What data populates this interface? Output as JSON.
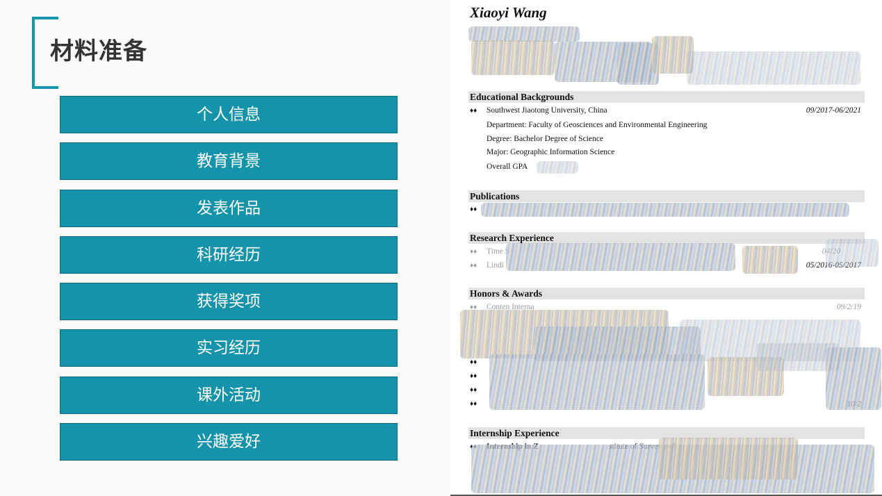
{
  "slide": {
    "title": "材料准备",
    "menu": [
      {
        "label": "个人信息"
      },
      {
        "label": "教育背景"
      },
      {
        "label": "发表作品"
      },
      {
        "label": "科研经历"
      },
      {
        "label": "获得奖项"
      },
      {
        "label": "实习经历"
      },
      {
        "label": "课外活动"
      },
      {
        "label": "兴趣爱好"
      }
    ],
    "accent_color": "#1593ab"
  },
  "resume": {
    "name": "Xiaoyi Wang",
    "sections": {
      "education": {
        "heading": "Educational Backgrounds",
        "school": "Southwest Jiaotong University, China",
        "dates": "09/2017-06/2021",
        "department": "Department: Faculty of Geosciences and Environmental Engineering",
        "degree": "Degree: Bachelor Degree of Science",
        "major": "Major: Geographic Information Science",
        "gpa_label": "Overall GPA"
      },
      "publications": {
        "heading": "Publications"
      },
      "research": {
        "heading": "Research Experience",
        "item1_start": "Time S",
        "item1_date": "04/20",
        "item2_start": "Lindi",
        "item2_date": "05/2016-05/2017"
      },
      "honors": {
        "heading": "Honors & Awards",
        "item1_start": "Conten Interna",
        "item1_date": "09/2/19",
        "last_date": "10/2"
      },
      "internship": {
        "heading": "Internship Experience",
        "item1": "Internship in Z",
        "item1_tail": "stitute of Survey and"
      }
    },
    "bullet_glyph": "♦♦"
  }
}
